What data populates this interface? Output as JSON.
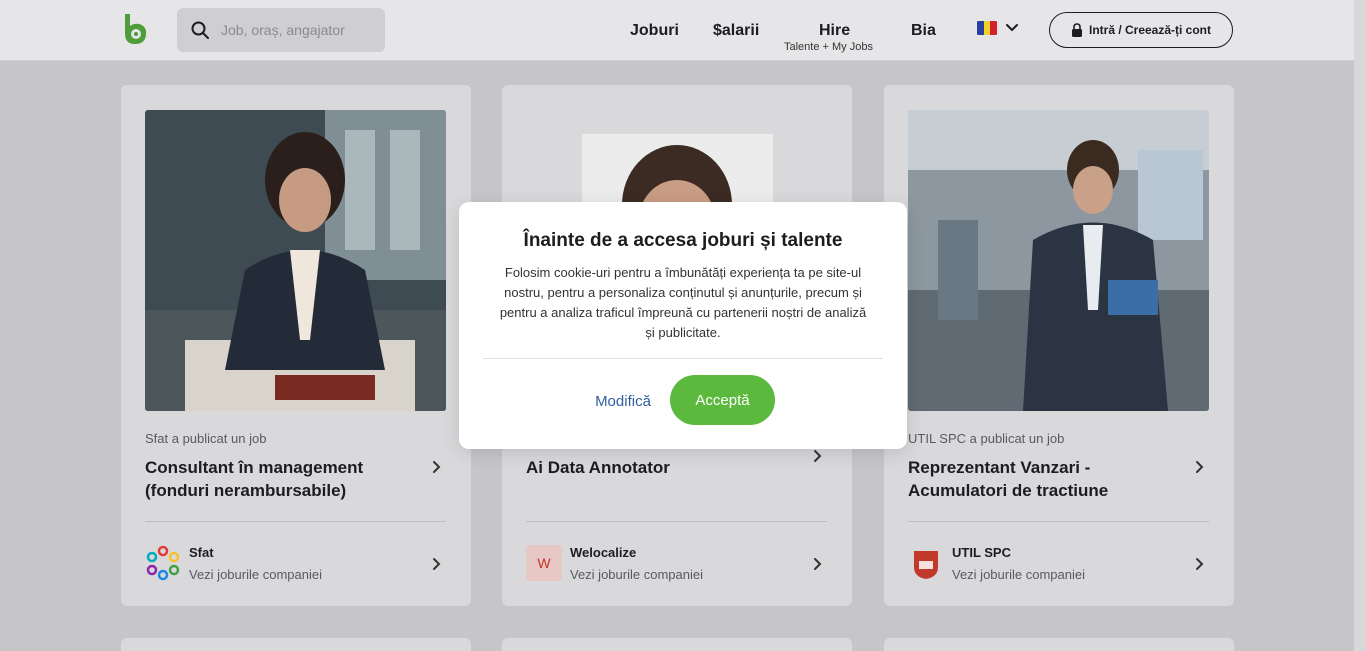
{
  "header": {
    "search_placeholder": "Job, oraș, angajator",
    "nav": {
      "jobs": "Joburi",
      "salaries": "$alarii",
      "hire": "Hire",
      "hire_sub": "Talente + My Jobs",
      "bia": "Bia"
    },
    "language_flag": "ro-flag",
    "login_label": "Intră / Creează-ți cont"
  },
  "cards": [
    {
      "publisher": "Sfat a publicat un job",
      "title": "Consultant în management (fonduri nerambursabile)",
      "company": "Sfat",
      "company_link": "Vezi joburile companiei"
    },
    {
      "publisher": "",
      "title": "Ai Data Annotator",
      "company": "Welocalize",
      "company_logo_letter": "W",
      "company_link": "Vezi joburile companiei"
    },
    {
      "publisher": "UTIL SPC a publicat un job",
      "title": "Reprezentant Vanzari - Acumulatori de tractiune",
      "company": "UTIL SPC",
      "company_link": "Vezi joburile companiei"
    }
  ],
  "modal": {
    "title": "Înainte de a accesa joburi și talente",
    "body": "Folosim cookie-uri pentru a îmbunătăți experiența ta pe site-ul nostru, pentru a personaliza conținutul și anunțurile, precum și pentru a analiza traficul împreună cu partenerii noștri de analiză și publicitate.",
    "modify_label": "Modifică",
    "accept_label": "Acceptă"
  },
  "colors": {
    "accent_green": "#5bba3e",
    "link_blue": "#2f5f9e"
  }
}
